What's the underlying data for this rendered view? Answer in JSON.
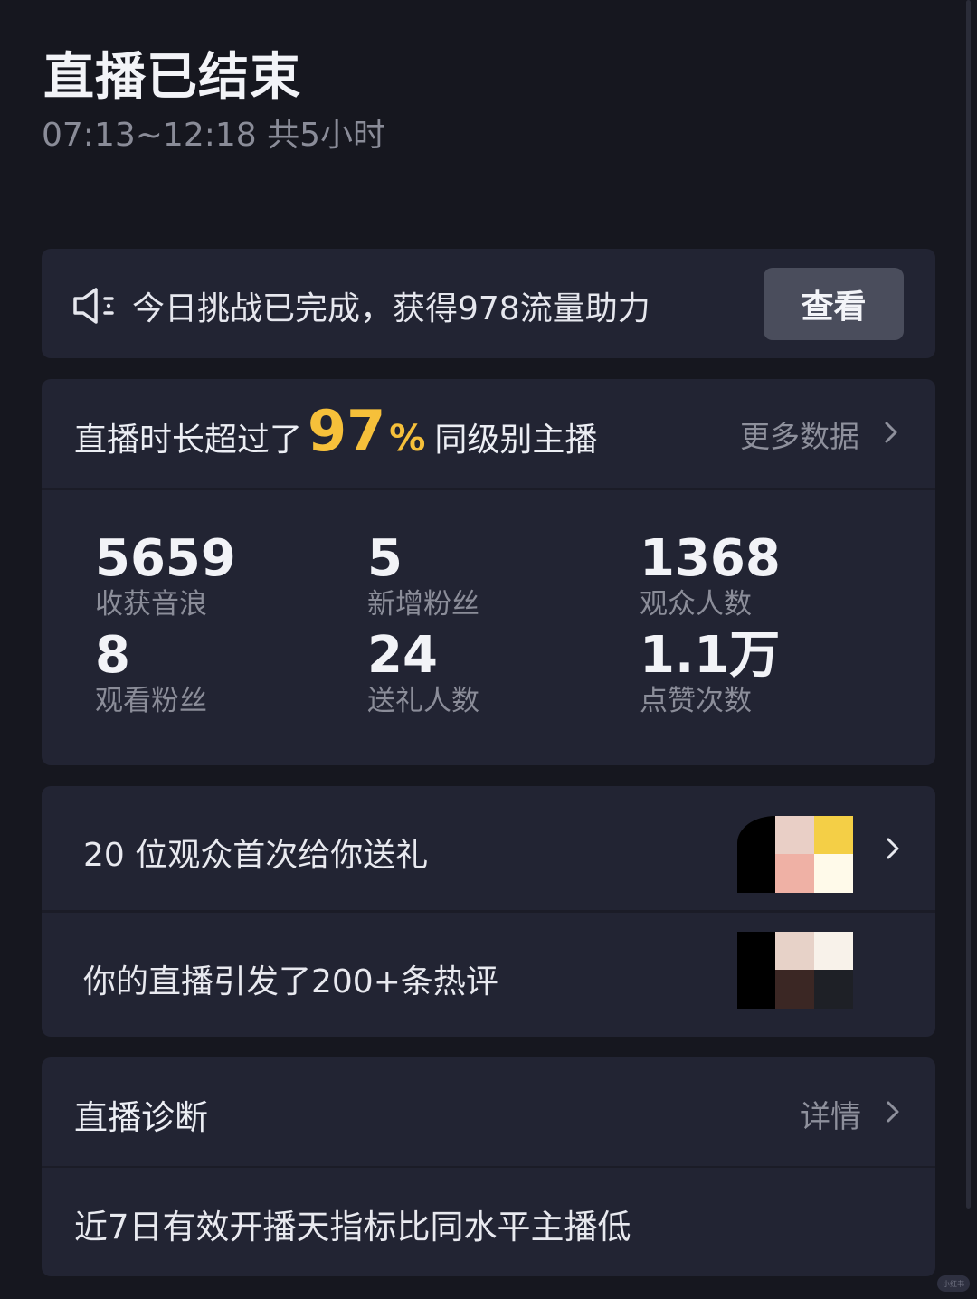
{
  "header": {
    "title": "直播已结束",
    "time_range": "07:13~12:18 共5小时"
  },
  "challenge": {
    "icon": "speaker-icon",
    "text": "今日挑战已完成，获得978流量助力",
    "button_label": "查看"
  },
  "summary": {
    "prefix": "直播时长超过了",
    "percent": "97",
    "percent_sign": "%",
    "suffix": "同级别主播",
    "more_label": "更多数据",
    "accent_color": "#f6c03a"
  },
  "stats": [
    {
      "value": "5659",
      "label": "收获音浪"
    },
    {
      "value": "5",
      "label": "新增粉丝"
    },
    {
      "value": "1368",
      "label": "观众人数"
    },
    {
      "value": "8",
      "label": "观看粉丝"
    },
    {
      "value": "24",
      "label": "送礼人数"
    },
    {
      "value": "1.1万",
      "label": "点赞次数"
    }
  ],
  "gifts": {
    "first_gift_text": "20 位观众首次给你送礼",
    "comments_text": "你的直播引发了200+条热评"
  },
  "diagnosis": {
    "title": "直播诊断",
    "details_label": "详情",
    "message": "近7日有效开播天指标比同水平主播低"
  },
  "watermark": "小红书"
}
